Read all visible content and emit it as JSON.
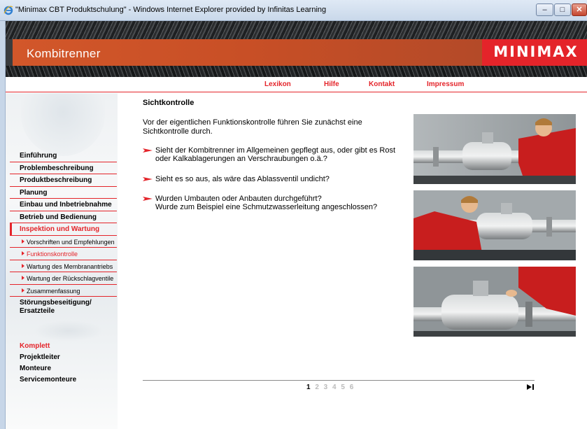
{
  "window": {
    "title": "\"Minimax CBT Produktschulung\" - Windows Internet Explorer provided by Infinitas Learning",
    "controls": {
      "minimize": "–",
      "maximize": "□",
      "close": "✕"
    }
  },
  "header": {
    "course_title": "Kombitrenner",
    "logo": "MINIMAX",
    "brand_color": "#e4242a",
    "banner_color": "#c84f26"
  },
  "topnav": {
    "items": [
      "Lexikon",
      "Hilfe",
      "Kontakt",
      "Impressum"
    ]
  },
  "sidebar": {
    "menu": [
      "Einführung",
      "Problembeschreibung",
      "Produktbeschreibung",
      "Planung",
      "Einbau und Inbetriebnahme",
      "Betrieb und Bedienung",
      "Inspektion und Wartung"
    ],
    "submenu": [
      "Vorschriften und Empfehlungen",
      "Funktionskontrolle",
      "Wartung des Membranantriebs",
      "Wartung der Rückschlagventile",
      "Zusammenfassung"
    ],
    "last_menu_line1": "Störungsbeseitigung/",
    "last_menu_line2": "Ersatzteile",
    "roles": [
      "Komplett",
      "Projektleiter",
      "Monteure",
      "Servicemonteure"
    ]
  },
  "main": {
    "heading": "Sichtkontrolle",
    "intro": "Vor der eigentlichen Funktionskontrolle führen Sie zunächst eine Sichtkontrolle durch.",
    "bullets": [
      {
        "line1": "Sieht der Kombitrenner im Allgemeinen gepflegt aus, oder gibt es Rost",
        "line2": "oder Kalkablagerungen an Verschraubungen o.ä.?"
      },
      {
        "line1": "Sieht es so aus, als wäre das Ablassventil undicht?",
        "line2": ""
      },
      {
        "line1": "Wurden Umbauten oder Anbauten durchgeführt?",
        "line2": "Wurde zum Beispiel eine Schmutzwasserleitung angeschlossen?"
      }
    ]
  },
  "pager": {
    "current": "1",
    "others": "2 3 4 5 6",
    "next_icon": "skip-forward-icon"
  }
}
